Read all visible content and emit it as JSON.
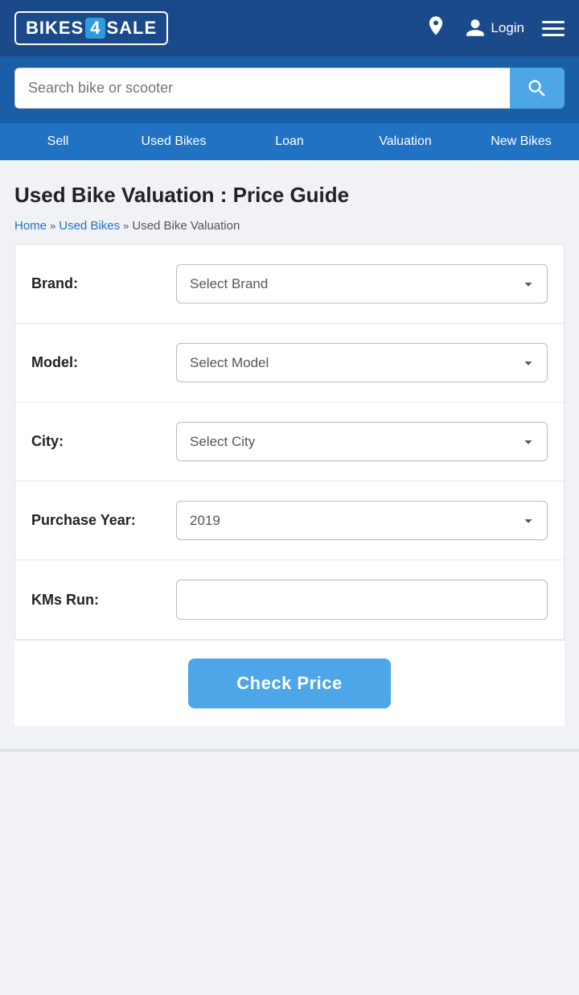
{
  "header": {
    "logo": {
      "prefix": "BIKES",
      "number": "4",
      "suffix": "SALE"
    },
    "login_label": "Login",
    "location_icon": "location-icon",
    "user_icon": "user-icon",
    "menu_icon": "menu-icon"
  },
  "search": {
    "placeholder": "Search bike or scooter",
    "button_icon": "search-icon"
  },
  "nav": {
    "items": [
      {
        "label": "Sell"
      },
      {
        "label": "Used Bikes"
      },
      {
        "label": "Loan"
      },
      {
        "label": "Valuation"
      },
      {
        "label": "New Bikes"
      }
    ]
  },
  "page": {
    "title": "Used Bike Valuation : Price Guide",
    "breadcrumb": {
      "home": "Home",
      "used_bikes": "Used Bikes",
      "current": "Used Bike Valuation"
    }
  },
  "form": {
    "brand_label": "Brand:",
    "brand_placeholder": "Select Brand",
    "model_label": "Model:",
    "model_placeholder": "Select Model",
    "city_label": "City:",
    "city_placeholder": "Select City",
    "year_label": "Purchase Year:",
    "year_value": "2019",
    "kms_label": "KMs Run:",
    "kms_placeholder": "",
    "check_price_label": "Check Price"
  }
}
